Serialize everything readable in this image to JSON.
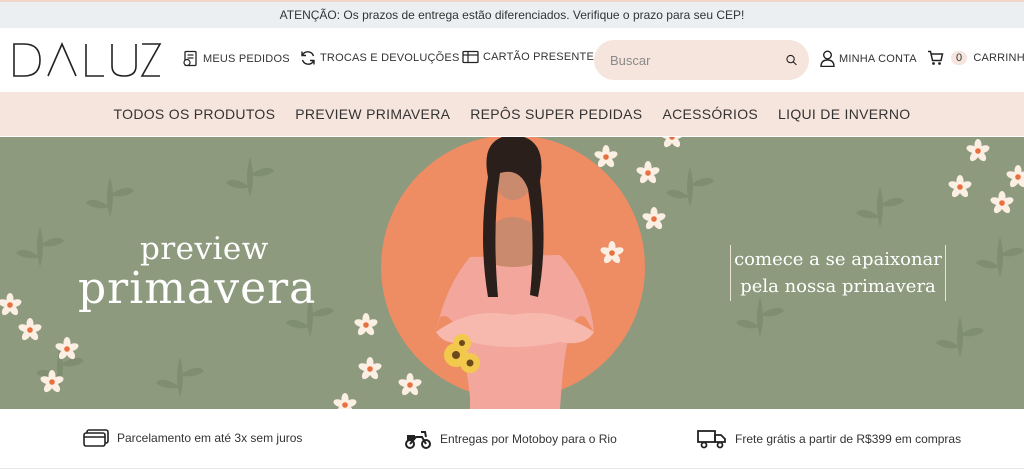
{
  "announcement": "ATENÇÃO: Os prazos de entrega estão diferenciados. Verifique o prazo para seu CEP!",
  "header": {
    "logo_text": "DALUZ",
    "links": {
      "orders": "MEUS PEDIDOS",
      "returns": "TROCAS E DEVOLUÇÕES",
      "gift_card": "CARTÃO PRESENTE",
      "account": "MINHA CONTA",
      "cart": "CARRINHO"
    },
    "cart_count": "0",
    "search": {
      "placeholder": "Buscar",
      "value": ""
    }
  },
  "nav": {
    "items": [
      "TODOS OS PRODUTOS",
      "PREVIEW PRIMAVERA",
      "REPÔS SUPER PEDIDAS",
      "ACESSÓRIOS",
      "LIQUI DE INVERNO"
    ]
  },
  "hero": {
    "title_line1": "preview",
    "title_line2": "primavera",
    "side_line1": "comece a se apaixonar",
    "side_line2": "pela nossa primavera"
  },
  "benefits": {
    "installments": "Parcelamento em até 3x sem juros",
    "motoboy": "Entregas por Motoboy para o Rio",
    "free_shipping": "Frete grátis a partir de R$399 em compras"
  },
  "colors": {
    "accent_pink": "#f6e5dd",
    "hero_green": "#8d9a7d",
    "hero_circle": "#ee8c64",
    "dress_pink": "#f3a79c"
  },
  "icons": {
    "orders": "receipt-icon",
    "returns": "refresh-icon",
    "gift_card": "gift-card-icon",
    "search": "search-icon",
    "account": "user-icon",
    "cart": "cart-icon",
    "installments": "credit-card-icon",
    "motoboy": "motorcycle-icon",
    "free_shipping": "truck-icon"
  }
}
